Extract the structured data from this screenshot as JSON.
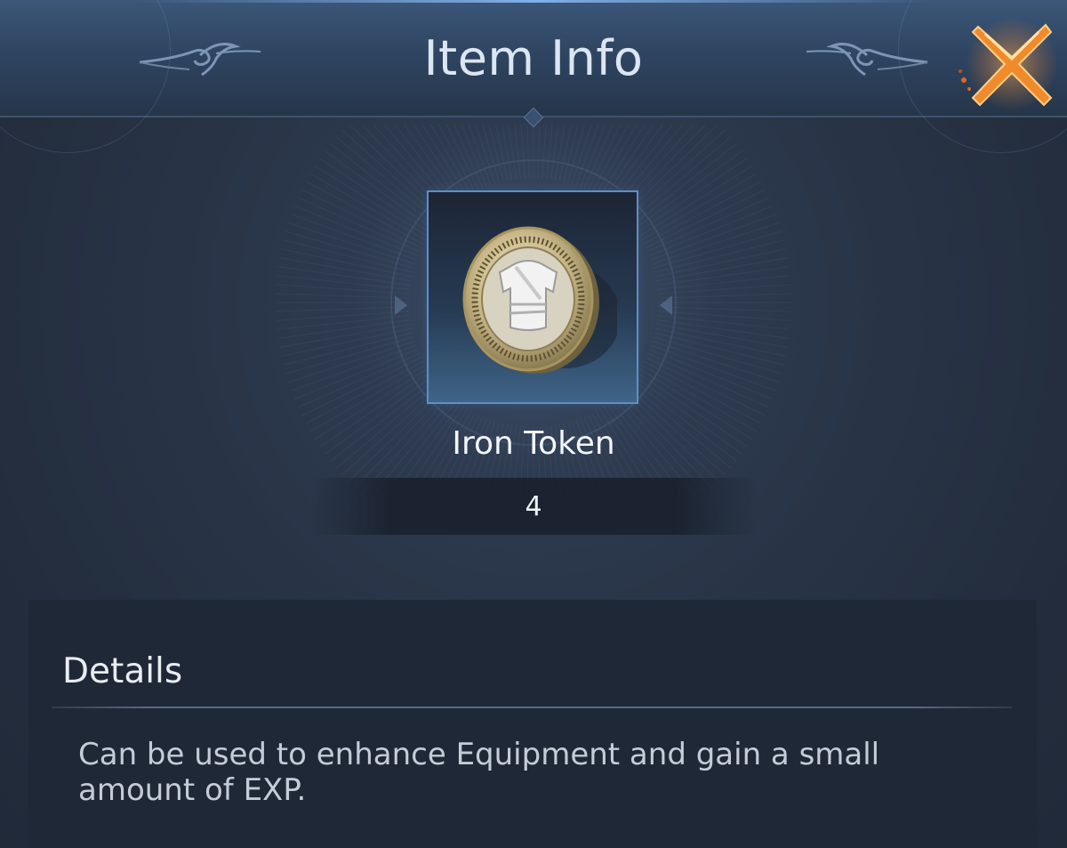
{
  "header": {
    "title": "Item Info",
    "close_icon": "close-x-icon"
  },
  "item": {
    "name": "Iron Token",
    "quantity": "4",
    "icon": "iron-token-coin-icon"
  },
  "details": {
    "heading": "Details",
    "description": "Can be used to enhance Equipment and gain a small amount of EXP."
  },
  "colors": {
    "accent_blue": "#5e8fc4",
    "close_orange": "#f08a2a",
    "panel_bg": "#242f40"
  }
}
